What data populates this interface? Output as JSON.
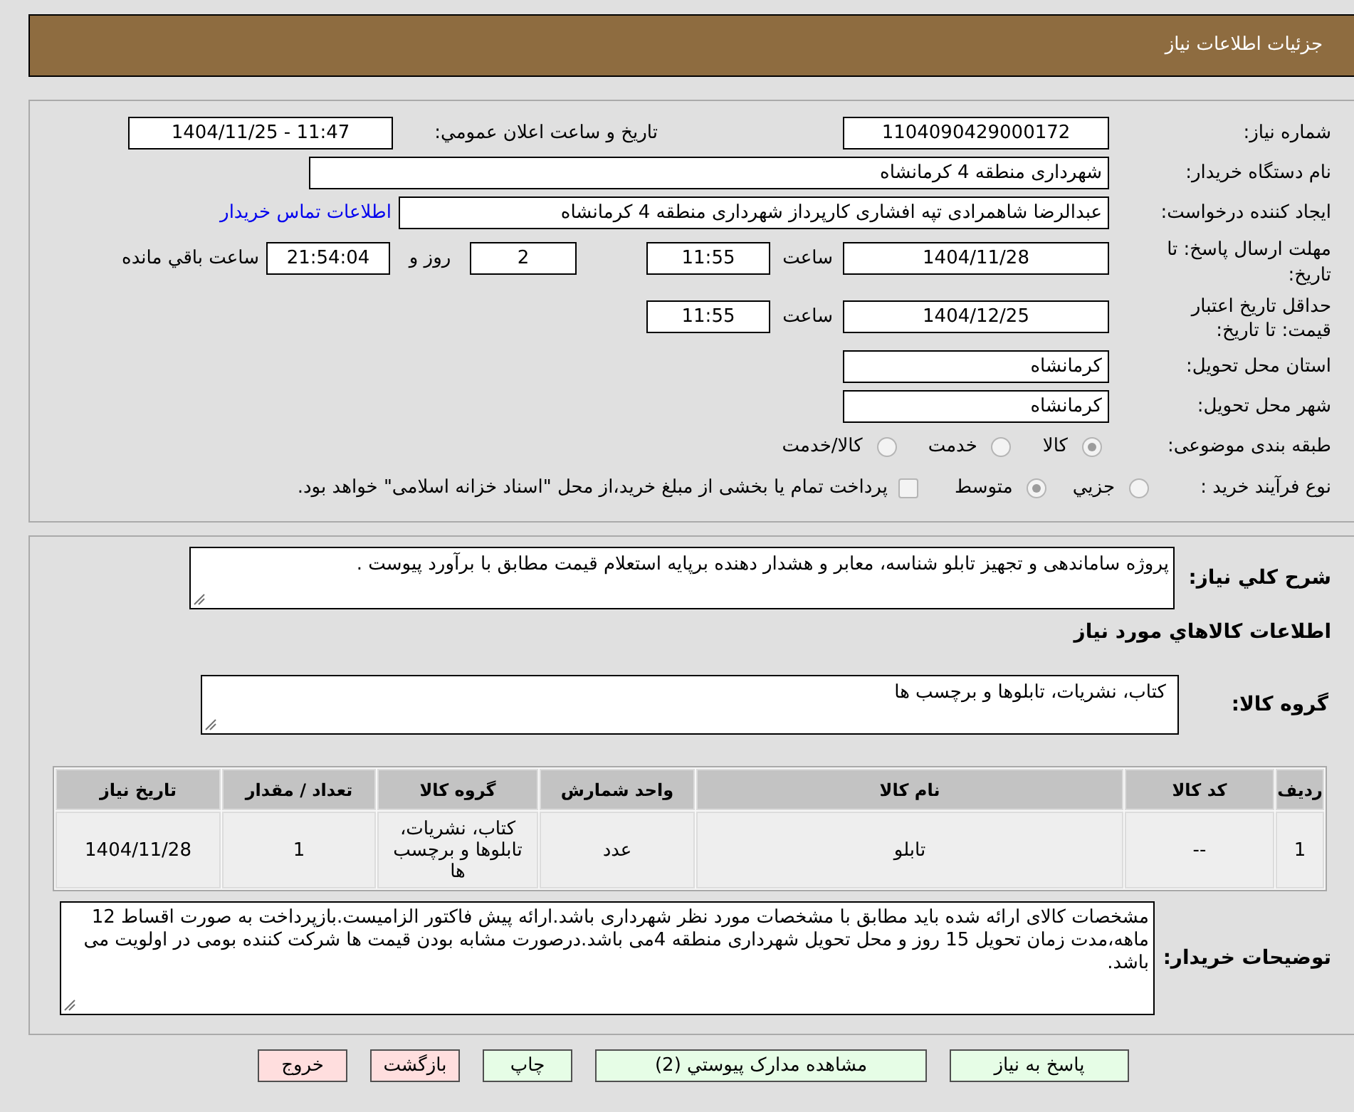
{
  "header": {
    "title": "جزئیات اطلاعات نیاز"
  },
  "details": {
    "need_number": {
      "label": "شماره نیاز:",
      "value": "1104090429000172"
    },
    "announce": {
      "label": "تاریخ و ساعت اعلان عمومي:",
      "value": "1404/11/25 - 11:47"
    },
    "buyer_org": {
      "label": "نام دستگاه خریدار:",
      "value": "شهرداری منطقه 4 کرمانشاه"
    },
    "creator": {
      "label": "ایجاد کننده درخواست:",
      "value": "عبدالرضا شاهمرادی تپه افشاری کارپرداز شهرداری منطقه 4 کرمانشاه",
      "link": "اطلاعات تماس خریدار"
    },
    "deadline": {
      "label": "مهلت ارسال پاسخ: تا تاریخ:",
      "date": "1404/11/28",
      "time_label": "ساعت",
      "time": "11:55",
      "days": "2",
      "days_label": "روز و",
      "remaining": "21:54:04",
      "remaining_label": "ساعت باقي مانده"
    },
    "validity": {
      "label": "حداقل تاریخ اعتبار قیمت: تا تاریخ:",
      "date": "1404/12/25",
      "time_label": "ساعت",
      "time": "11:55"
    },
    "province": {
      "label": "استان محل تحویل:",
      "value": "کرمانشاه"
    },
    "city": {
      "label": "شهر محل تحویل:",
      "value": "کرمانشاه"
    },
    "category": {
      "label": "طبقه بندی موضوعی:",
      "options": [
        {
          "label": "کالا",
          "selected": true
        },
        {
          "label": "خدمت",
          "selected": false
        },
        {
          "label": "کالا/خدمت",
          "selected": false
        }
      ]
    },
    "process": {
      "label": "نوع فرآیند خرید :",
      "options": [
        {
          "label": "جزيي",
          "selected": false
        },
        {
          "label": "متوسط",
          "selected": true
        }
      ],
      "treasury": {
        "label": "پرداخت تمام یا بخشی از مبلغ خرید،از محل \"اسناد خزانه اسلامی\" خواهد بود.",
        "checked": false
      }
    }
  },
  "summary": {
    "label": "شرح كلي نياز:",
    "value": "پروژه ساماندهی و تجهیز تابلو شناسه، معابر و هشدار دهنده  برپایه استعلام قیمت مطابق با برآورد پیوست ."
  },
  "items_heading": "اطلاعات كالاهاي مورد نياز",
  "goods_group": {
    "label": "گروه کالا:",
    "value": "کتاب، نشریات، تابلوها و برچسب ها"
  },
  "table": {
    "columns": [
      "ردیف",
      "کد کالا",
      "نام کالا",
      "واحد شمارش",
      "گروه کالا",
      "تعداد / مقدار",
      "تاریخ نیاز"
    ],
    "rows": [
      [
        "1",
        "--",
        "تابلو",
        "عدد",
        "کتاب، نشریات، تابلوها و برچسب ها",
        "1",
        "1404/11/28"
      ]
    ]
  },
  "buyer_notes": {
    "label": "توضیحات خریدار:",
    "value": "مشخصات کالای ارائه شده باید مطابق با مشخصات مورد نظر شهرداری باشد.ارائه پیش فاکتور الزامیست.بازپرداخت به صورت اقساط 12 ماهه،مدت زمان تحویل 15 روز و محل تحویل شهرداری منطقه 4می باشد.درصورت مشابه بودن قیمت ها شرکت کننده بومی در اولویت می باشد."
  },
  "buttons": [
    {
      "label": "پاسخ به نیاز",
      "kind": "action"
    },
    {
      "label": "مشاهده مدارک پیوستي (2)",
      "kind": "action"
    },
    {
      "label": "چاپ",
      "kind": "action"
    },
    {
      "label": "بازگشت",
      "kind": "leave"
    },
    {
      "label": "خروج",
      "kind": "leave"
    }
  ]
}
